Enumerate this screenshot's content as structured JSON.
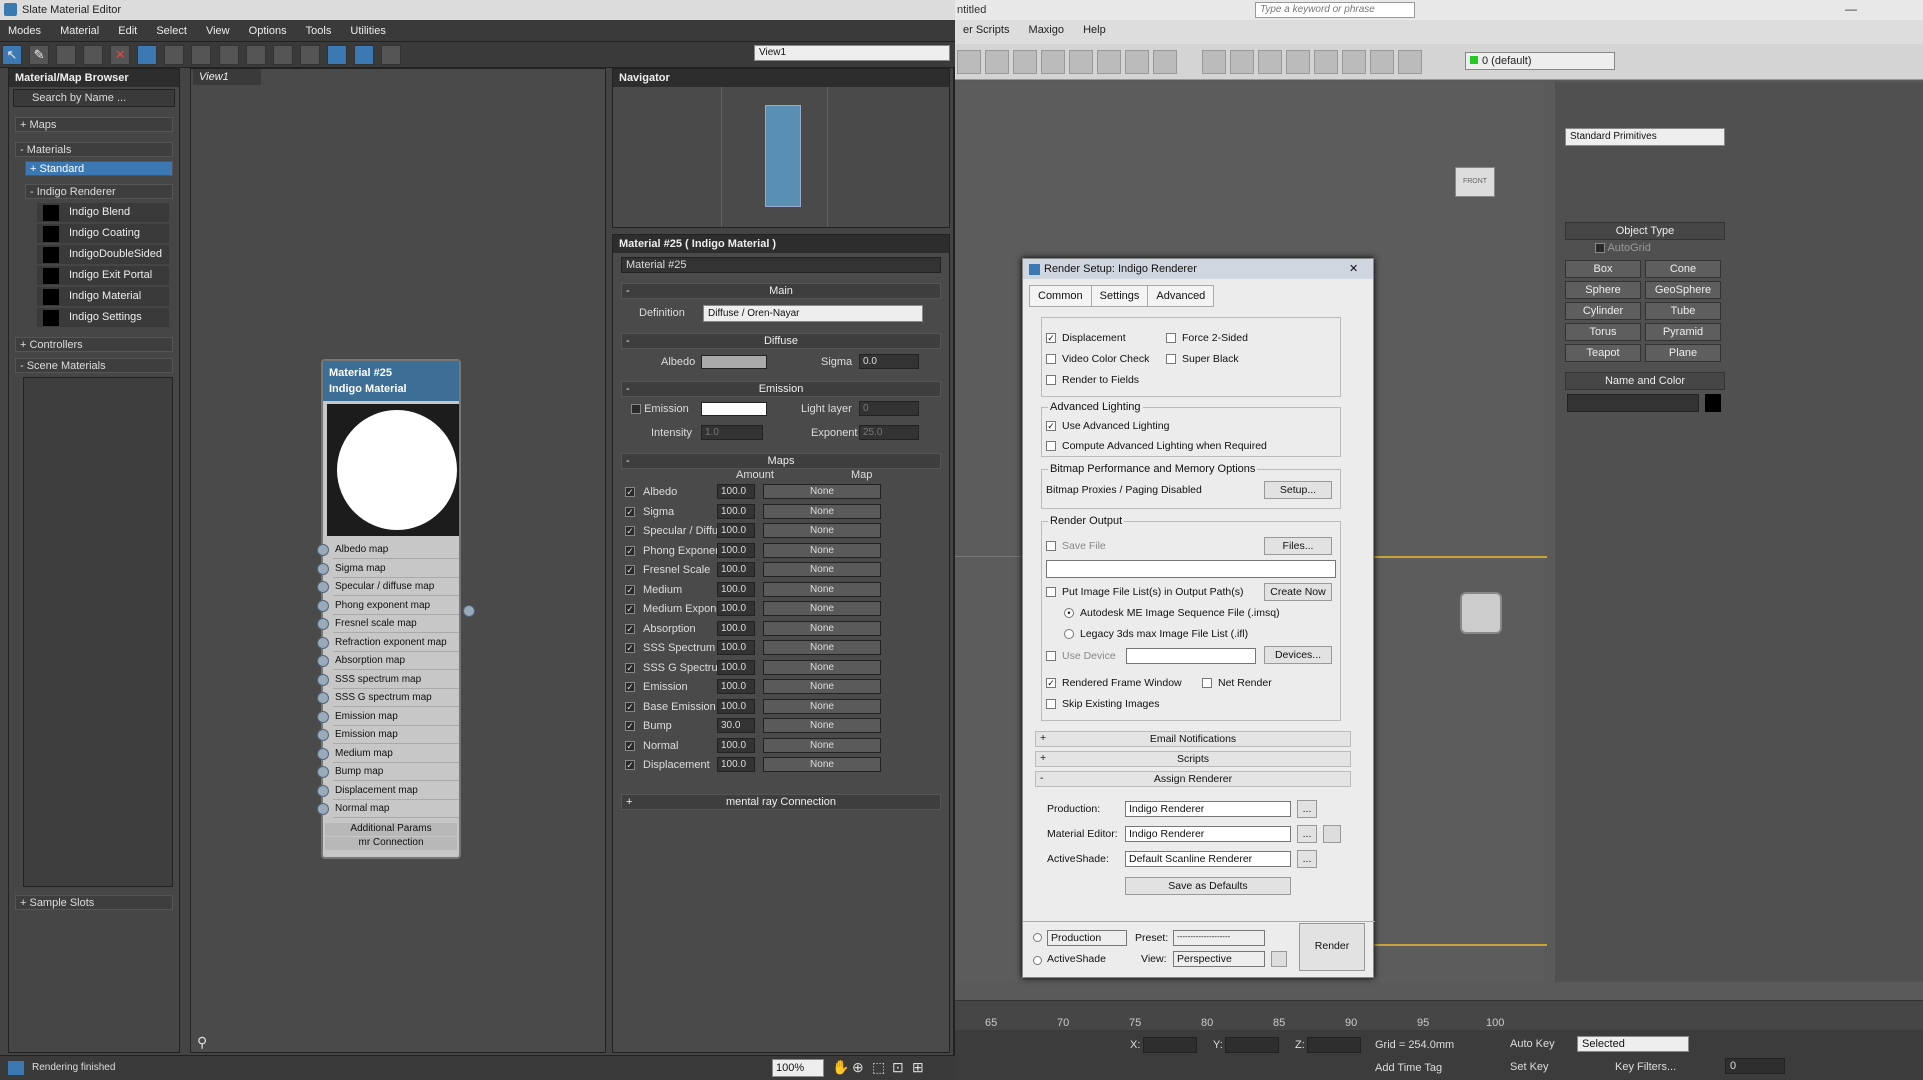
{
  "sme": {
    "title": "Slate Material Editor",
    "menus": [
      "Modes",
      "Material",
      "Edit",
      "Select",
      "View",
      "Options",
      "Tools",
      "Utilities"
    ],
    "view_dropdown": "View1",
    "browser": {
      "title": "Material/Map Browser",
      "search_placeholder": "Search by Name ...",
      "maps": "+ Maps",
      "materials": "- Materials",
      "standard": "+ Standard",
      "indigo": "- Indigo Renderer",
      "items": [
        "Indigo Blend",
        "Indigo Coating",
        "IndigoDoubleSided",
        "Indigo Exit Portal",
        "Indigo Material",
        "Indigo Settings"
      ],
      "controllers": "+ Controllers",
      "scene_materials": "- Scene Materials",
      "sample_slots": "+ Sample Slots"
    },
    "view_tab": "View1",
    "node": {
      "name": "Material #25",
      "type": "Indigo Material",
      "slots": [
        "Albedo map",
        "Sigma map",
        "Specular / diffuse map",
        "Phong exponent map",
        "Fresnel scale map",
        "Refraction exponent map",
        "Absorption map",
        "SSS spectrum map",
        "SSS G spectrum map",
        "Emission map",
        "Emission map",
        "Medium map",
        "Bump map",
        "Displacement map",
        "Normal map"
      ],
      "additional": "Additional Params",
      "mr": "mr Connection"
    },
    "navigator": "Navigator",
    "params": {
      "title": "Material #25  ( Indigo Material )",
      "name": "Material #25",
      "main": "Main",
      "definition_label": "Definition",
      "definition_value": "Diffuse / Oren-Nayar",
      "diffuse": "Diffuse",
      "albedo_label": "Albedo",
      "sigma_label": "Sigma",
      "sigma_value": "0.0",
      "emission_head": "Emission",
      "emission_label": "Emission",
      "light_layer_label": "Light layer",
      "light_layer_value": "0",
      "intensity_label": "Intensity",
      "intensity_value": "1.0",
      "exponent_label": "Exponent",
      "exponent_value": "25.0",
      "maps": "Maps",
      "amount_head": "Amount",
      "map_head": "Map",
      "map_rows": [
        {
          "label": "Albedo",
          "amount": "100.0",
          "map": "None"
        },
        {
          "label": "Sigma",
          "amount": "100.0",
          "map": "None"
        },
        {
          "label": "Specular / Diffuse",
          "amount": "100.0",
          "map": "None"
        },
        {
          "label": "Phong Exponent",
          "amount": "100.0",
          "map": "None"
        },
        {
          "label": "Fresnel Scale",
          "amount": "100.0",
          "map": "None"
        },
        {
          "label": "Medium",
          "amount": "100.0",
          "map": "None"
        },
        {
          "label": "Medium Exponent",
          "amount": "100.0",
          "map": "None"
        },
        {
          "label": "Absorption",
          "amount": "100.0",
          "map": "None"
        },
        {
          "label": "SSS Spectrum",
          "amount": "100.0",
          "map": "None"
        },
        {
          "label": "SSS G Spectrum",
          "amount": "100.0",
          "map": "None"
        },
        {
          "label": "Emission",
          "amount": "100.0",
          "map": "None"
        },
        {
          "label": "Base Emission",
          "amount": "100.0",
          "map": "None"
        },
        {
          "label": "Bump",
          "amount": "30.0",
          "map": "None"
        },
        {
          "label": "Normal",
          "amount": "100.0",
          "map": "None"
        },
        {
          "label": "Displacement",
          "amount": "100.0",
          "map": "None"
        }
      ],
      "mental_ray": "mental ray Connection"
    },
    "status": "Rendering finished",
    "zoom": "100%"
  },
  "max": {
    "title_right": "ntitled",
    "search_placeholder": "Type a keyword or phrase",
    "menus": [
      "er Scripts",
      "Maxigo",
      "Help"
    ],
    "layer": "0 (default)",
    "viewcube": "FRONT",
    "cmd": {
      "primitives": "Standard Primitives",
      "object_type": "Object Type",
      "autogrid": "AutoGrid",
      "buttons": [
        "Box",
        "Cone",
        "Sphere",
        "GeoSphere",
        "Cylinder",
        "Tube",
        "Torus",
        "Pyramid",
        "Teapot",
        "Plane"
      ],
      "name_color": "Name and Color"
    },
    "ticks": [
      "65",
      "70",
      "75",
      "80",
      "85",
      "90",
      "95",
      "100"
    ],
    "status": {
      "x": "X:",
      "y": "Y:",
      "z": "Z:",
      "grid": "Grid = 254.0mm",
      "auto_key": "Auto Key",
      "selected": "Selected",
      "set_key": "Set Key",
      "key_filters": "Key Filters...",
      "add_time_tag": "Add Time Tag",
      "frame": "0"
    }
  },
  "render_setup": {
    "title": "Render Setup: Indigo Renderer",
    "tabs": [
      "Common",
      "Settings",
      "Advanced"
    ],
    "opts": {
      "displacement": "Displacement",
      "force2": "Force 2-Sided",
      "video": "Video Color Check",
      "super_black": "Super Black",
      "render_fields": "Render to Fields"
    },
    "adv_light": {
      "title": "Advanced Lighting",
      "use": "Use Advanced Lighting",
      "compute": "Compute Advanced Lighting when Required"
    },
    "bitmap": {
      "title": "Bitmap Performance and Memory Options",
      "text": "Bitmap Proxies / Paging Disabled",
      "setup": "Setup..."
    },
    "output": {
      "title": "Render Output",
      "save_file": "Save File",
      "files": "Files...",
      "put_list": "Put Image File List(s) in Output Path(s)",
      "create_now": "Create Now",
      "autodesk": "Autodesk ME Image Sequence File (.imsq)",
      "legacy": "Legacy 3ds max Image File List (.ifl)",
      "use_device": "Use Device",
      "devices": "Devices...",
      "rendered_frame": "Rendered Frame Window",
      "net_render": "Net Render",
      "skip": "Skip Existing Images"
    },
    "email": "Email Notifications",
    "scripts": "Scripts",
    "assign": "Assign Renderer",
    "production_label": "Production:",
    "production_value": "Indigo Renderer",
    "mat_editor_label": "Material Editor:",
    "mat_editor_value": "Indigo Renderer",
    "activeshade_label": "ActiveShade:",
    "activeshade_value": "Default Scanline Renderer",
    "save_defaults": "Save as Defaults",
    "ellipsis": "...",
    "mode": "Production",
    "preset_label": "Preset:",
    "preset_value": "--------------------",
    "activeshade_opt": "ActiveShade",
    "view_label": "View:",
    "view_value": "Perspective",
    "render": "Render"
  }
}
